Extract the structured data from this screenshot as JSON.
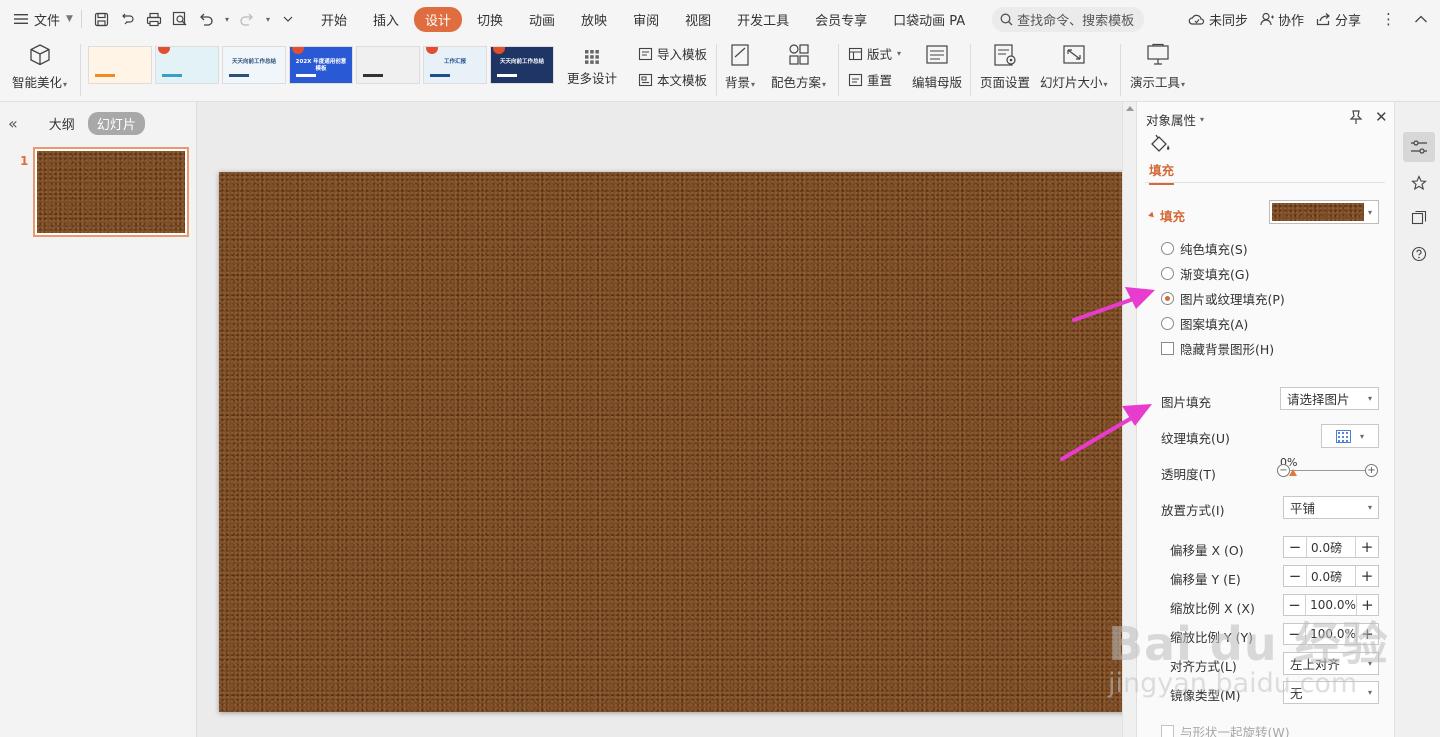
{
  "menubar": {
    "file_label": "文件",
    "tabs": [
      "开始",
      "插入",
      "设计",
      "切换",
      "动画",
      "放映",
      "审阅",
      "视图",
      "开发工具",
      "会员专享",
      "口袋动画 PA"
    ],
    "active_tab": "设计",
    "search_label": "查找命令、搜索模板",
    "sync_label": "未同步",
    "collab_label": "协作",
    "share_label": "分享"
  },
  "ribbon": {
    "smart_beautify": "智能美化",
    "more_design": "更多设计",
    "import_template": "导入模板",
    "this_template": "本文模板",
    "background": "背景",
    "color_scheme": "配色方案",
    "layout": "版式",
    "reset": "重置",
    "edit_master": "编辑母版",
    "page_setup": "页面设置",
    "slide_size": "幻灯片大小",
    "present_tools": "演示工具",
    "gallery": [
      {
        "caption": "",
        "theme": "#fff4e6",
        "accent": "#f08a24",
        "badge": false
      },
      {
        "caption": "",
        "theme": "#e3f2f7",
        "accent": "#3a9fc4",
        "badge": true
      },
      {
        "caption": "天天向前工作总结",
        "theme": "#f1f6fa",
        "accent": "#2c4f7a",
        "badge": false
      },
      {
        "caption": "202X 年度通用创意模板",
        "theme": "#2a59d6",
        "accent": "#ffffff",
        "badge": true
      },
      {
        "caption": "",
        "theme": "#f0f0f0",
        "accent": "#333333",
        "badge": false
      },
      {
        "caption": "工作汇报",
        "theme": "#e9f1f8",
        "accent": "#1f4e8c",
        "badge": true
      },
      {
        "caption": "天天向前工作总结",
        "theme": "#1e3566",
        "accent": "#ffffff",
        "badge": true
      }
    ]
  },
  "left_panel": {
    "outline_tab": "大纲",
    "slides_tab": "幻灯片",
    "slide_number": "1"
  },
  "pane": {
    "title": "对象属性",
    "fill_tab": "填充",
    "fill_section": "填充",
    "options": [
      {
        "label": "纯色填充(S)",
        "checked": false
      },
      {
        "label": "渐变填充(G)",
        "checked": false
      },
      {
        "label": "图片或纹理填充(P)",
        "checked": true
      },
      {
        "label": "图案填充(A)",
        "checked": false
      }
    ],
    "hide_bg_label": "隐藏背景图形(H)",
    "picture_fill_label": "图片填充",
    "picture_fill_value": "请选择图片",
    "texture_fill_label": "纹理填充(U)",
    "transparency_label": "透明度(T)",
    "transparency_value": "0%",
    "placement_label": "放置方式(I)",
    "placement_value": "平铺",
    "offset_x_label": "偏移量 X (O)",
    "offset_x_value": "0.0磅",
    "offset_y_label": "偏移量 Y (E)",
    "offset_y_value": "0.0磅",
    "scale_x_label": "缩放比例 X (X)",
    "scale_x_value": "100.0%",
    "scale_y_label": "缩放比例 Y (Y)",
    "scale_y_value": "100.0%",
    "align_label": "对齐方式(L)",
    "align_value": "左上对齐",
    "mirror_label": "镜像类型(M)",
    "mirror_value": "无",
    "rotate_label": "与形状一起旋转(W)"
  },
  "watermark": {
    "logo": "Bai du 经验",
    "url": "jingyan.baidu.com"
  },
  "colors": {
    "accent": "#e06d3f",
    "leather": "#7b4c25",
    "arrow": "#e83ccf"
  }
}
